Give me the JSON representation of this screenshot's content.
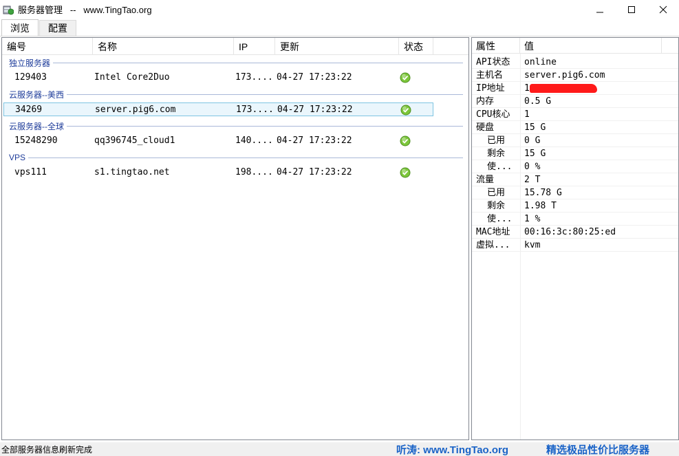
{
  "window": {
    "title": "服务器管理   --   www.TingTao.org",
    "minimize_glyph": "—",
    "maximize_glyph": "☐",
    "close_glyph": "✕"
  },
  "tabs": [
    {
      "label": "浏览",
      "active": true
    },
    {
      "label": "配置",
      "active": false
    }
  ],
  "server_list": {
    "columns": [
      "编号",
      "名称",
      "IP",
      "更新",
      "状态"
    ],
    "groups": [
      {
        "label": "独立服务器",
        "rows": [
          {
            "id": "129403",
            "name": "Intel Core2Duo",
            "ip": "173....",
            "updated": "04-27 17:23:22",
            "status": "ok"
          }
        ]
      },
      {
        "label": "云服务器--美西",
        "rows": [
          {
            "id": "34269",
            "name": "server.pig6.com",
            "ip": "173....",
            "updated": "04-27 17:23:22",
            "status": "ok",
            "selected": true
          }
        ]
      },
      {
        "label": "云服务器--全球",
        "rows": [
          {
            "id": "15248290",
            "name": "qq396745_cloud1",
            "ip": "140....",
            "updated": "04-27 17:23:22",
            "status": "ok"
          }
        ]
      },
      {
        "label": "VPS",
        "rows": [
          {
            "id": "vps111",
            "name": "s1.tingtao.net",
            "ip": "198....",
            "updated": "04-27 17:23:22",
            "status": "ok"
          }
        ]
      }
    ],
    "status_icon": "check-circle-icon",
    "status_color": "#6dbb2f"
  },
  "properties": {
    "columns": [
      "属性",
      "值"
    ],
    "rows": [
      {
        "key": "API状态",
        "value": "online",
        "indent": false
      },
      {
        "key": "主机名",
        "value": "server.pig6.com",
        "indent": false
      },
      {
        "key": "IP地址",
        "value": "1",
        "indent": false,
        "redacted": true
      },
      {
        "key": "内存",
        "value": "0.5 G",
        "indent": false
      },
      {
        "key": "CPU核心",
        "value": "1",
        "indent": false
      },
      {
        "key": "硬盘",
        "value": "15 G",
        "indent": false
      },
      {
        "key": "已用",
        "value": "0 G",
        "indent": true
      },
      {
        "key": "剩余",
        "value": "15 G",
        "indent": true
      },
      {
        "key": "使...",
        "value": "0 %",
        "indent": true
      },
      {
        "key": "流量",
        "value": "2 T",
        "indent": false
      },
      {
        "key": "已用",
        "value": "15.78 G",
        "indent": true
      },
      {
        "key": "剩余",
        "value": "1.98 T",
        "indent": true
      },
      {
        "key": "使...",
        "value": "1 %",
        "indent": true
      },
      {
        "key": "MAC地址",
        "value": "00:16:3c:80:25:ed",
        "indent": false
      },
      {
        "key": "虚拟...",
        "value": "kvm",
        "indent": false
      }
    ]
  },
  "statusbar": {
    "message": "全部服务器信息刷新完成",
    "brand_left": "听涛: www.TingTao.org",
    "brand_right": "精选极品性价比服务器",
    "brand_color": "#1a63c7"
  }
}
